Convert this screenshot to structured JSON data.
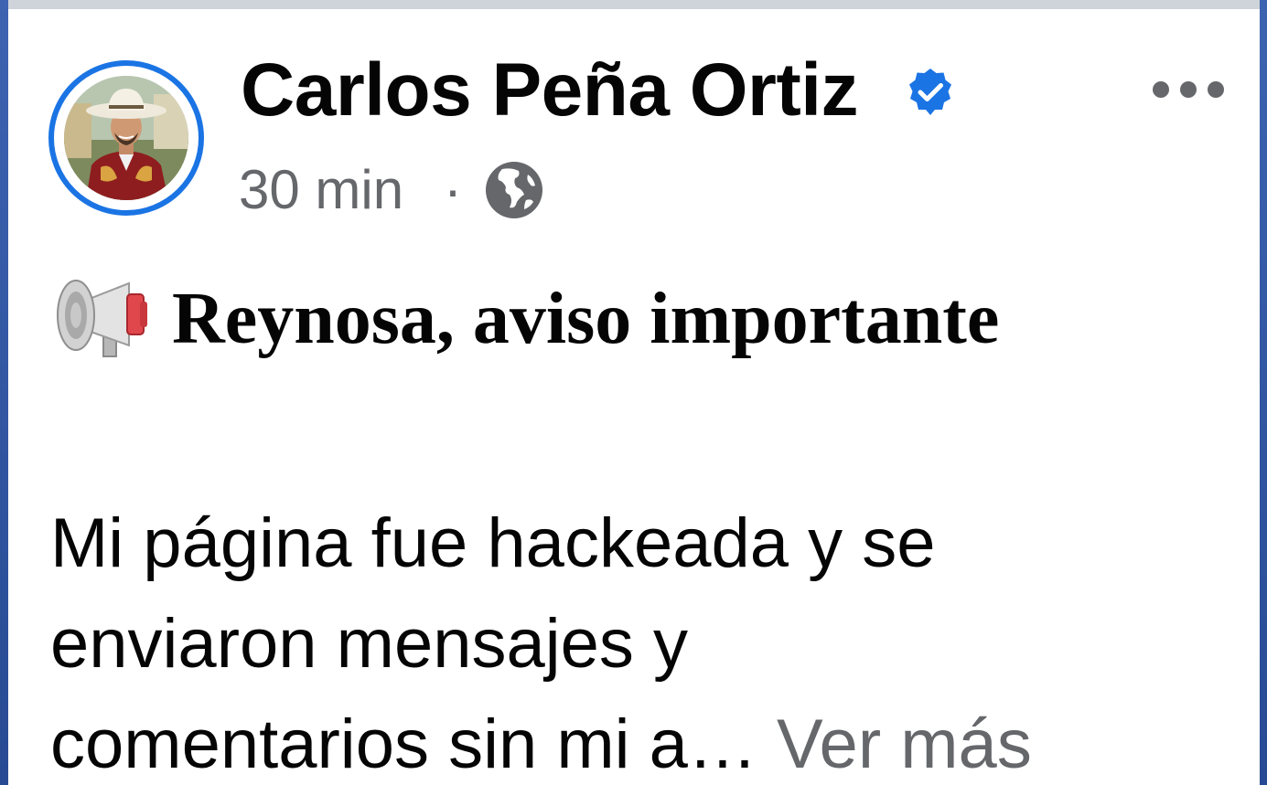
{
  "post": {
    "author": {
      "name": "Carlos Peña Ortiz",
      "verified": true,
      "avatar": "profile-photo"
    },
    "meta": {
      "time": "30 min",
      "separator": "·",
      "audience_icon": "globe-icon"
    },
    "more_icon": "more-options-icon",
    "headline_icon": "megaphone-icon",
    "headline": "Reynosa, aviso importante",
    "body_lines": [
      "Mi página fue hackeada y se",
      "enviaron mensajes y",
      "comentarios sin mi a…"
    ],
    "see_more": "Ver más"
  },
  "colors": {
    "verified_blue": "#1b74e4",
    "secondary_text": "#65676b",
    "primary_text": "#050505",
    "background": "#ffffff"
  }
}
